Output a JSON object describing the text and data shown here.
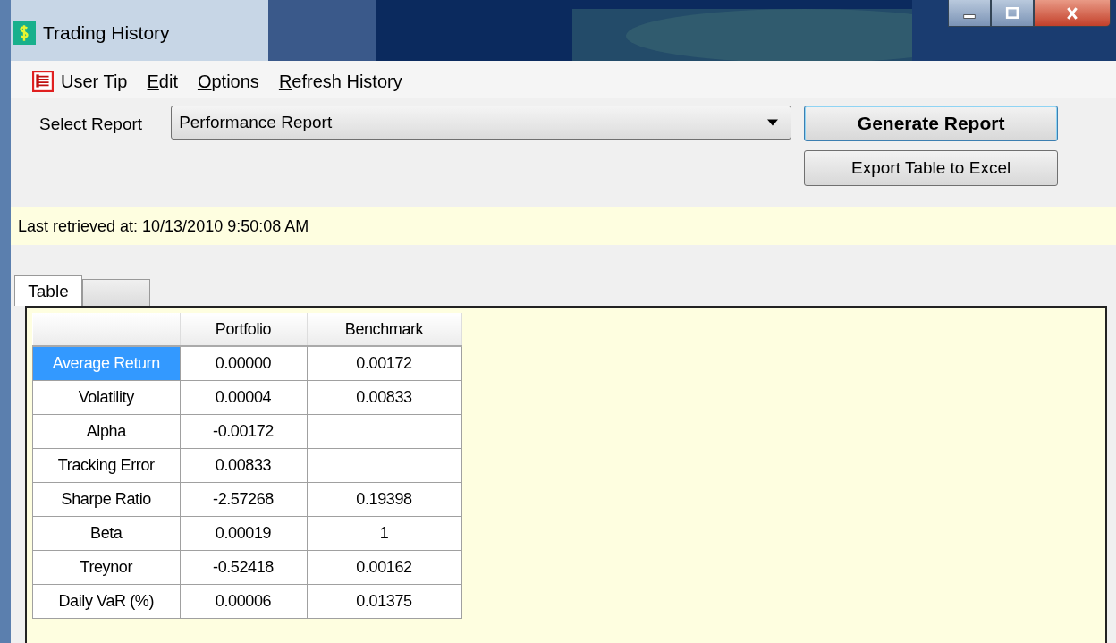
{
  "window": {
    "title": "Trading History"
  },
  "menu": [
    {
      "label": "User Tip",
      "kind": "icon",
      "mnemonic": false
    },
    {
      "label": "Edit",
      "kind": "plain",
      "mnemonic": true
    },
    {
      "label": "Options",
      "kind": "plain",
      "mnemonic": true
    },
    {
      "label": "Refresh History",
      "kind": "plain",
      "mnemonic": true
    }
  ],
  "report": {
    "label": "Select Report",
    "value": "Performance Report"
  },
  "buttons": [
    {
      "label": "Generate Report",
      "kind": "default"
    },
    {
      "label": "Export Table to Excel",
      "kind": "normal"
    }
  ],
  "status": "Last retrieved at: 10/13/2010 9:50:08 AM",
  "tabs": [
    {
      "label": "Table",
      "selected": true
    },
    {
      "selected": false
    }
  ],
  "table": {
    "columns": [
      "Portfolio",
      "Benchmark"
    ],
    "rows": [
      {
        "label": "Average Return",
        "selected": true,
        "cells": [
          "0.00000",
          "0.00172"
        ]
      },
      {
        "label": "Volatility",
        "selected": false,
        "cells": [
          "0.00004",
          "0.00833"
        ]
      },
      {
        "label": "Alpha",
        "selected": false,
        "cells": [
          "-0.00172",
          ""
        ]
      },
      {
        "label": "Tracking Error",
        "selected": false,
        "cells": [
          "0.00833",
          ""
        ]
      },
      {
        "label": "Sharpe Ratio",
        "selected": false,
        "cells": [
          "-2.57268",
          "0.19398"
        ]
      },
      {
        "label": "Beta",
        "selected": false,
        "cells": [
          "0.00019",
          "1"
        ]
      },
      {
        "label": "Treynor",
        "selected": false,
        "cells": [
          "-0.52418",
          "0.00162"
        ]
      },
      {
        "label": "Daily VaR (%)",
        "selected": false,
        "cells": [
          "0.00006",
          "0.01375"
        ]
      }
    ]
  }
}
